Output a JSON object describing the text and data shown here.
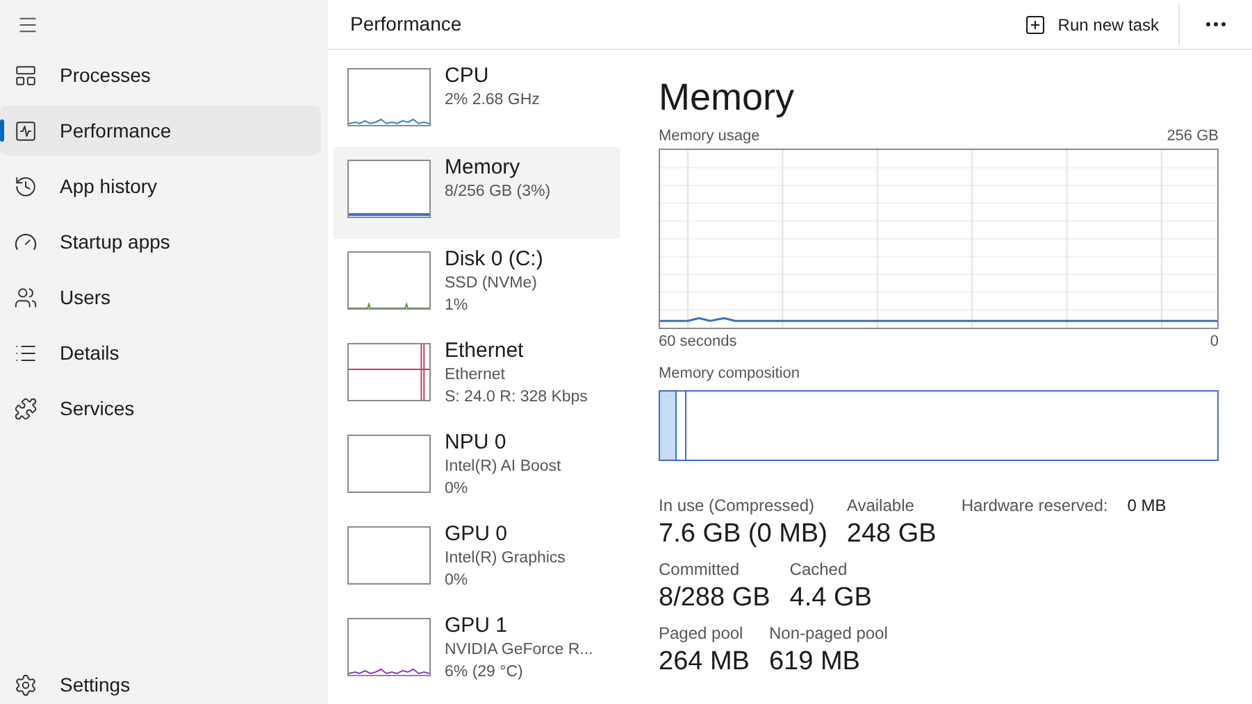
{
  "sidebar": {
    "items": [
      {
        "label": "Processes",
        "kind": "processes",
        "selected": false
      },
      {
        "label": "Performance",
        "kind": "performance",
        "selected": true
      },
      {
        "label": "App history",
        "kind": "history",
        "selected": false
      },
      {
        "label": "Startup apps",
        "kind": "startup",
        "selected": false
      },
      {
        "label": "Users",
        "kind": "users",
        "selected": false
      },
      {
        "label": "Details",
        "kind": "details",
        "selected": false
      },
      {
        "label": "Services",
        "kind": "services",
        "selected": false
      }
    ],
    "settings": "Settings"
  },
  "header": {
    "title": "Performance",
    "run_new_task": "Run new task"
  },
  "devices": [
    {
      "name": "CPU",
      "lines": [
        "2% 2.68 GHz"
      ],
      "kind": "cpu",
      "selected": false
    },
    {
      "name": "Memory",
      "lines": [
        "8/256 GB (3%)"
      ],
      "kind": "memory",
      "selected": true
    },
    {
      "name": "Disk 0 (C:)",
      "lines": [
        "SSD (NVMe)",
        "1%"
      ],
      "kind": "disk",
      "selected": false
    },
    {
      "name": "Ethernet",
      "lines": [
        "Ethernet",
        "S: 24.0 R: 328 Kbps"
      ],
      "kind": "network",
      "selected": false
    },
    {
      "name": "NPU 0",
      "lines": [
        "Intel(R) AI Boost",
        "0%"
      ],
      "kind": "idle",
      "selected": false
    },
    {
      "name": "GPU 0",
      "lines": [
        "Intel(R) Graphics",
        "0%"
      ],
      "kind": "idle",
      "selected": false
    },
    {
      "name": "GPU 1",
      "lines": [
        "NVIDIA GeForce R...",
        "6% (29 °C)"
      ],
      "kind": "gpu",
      "selected": false
    }
  ],
  "detail": {
    "title": "Memory",
    "usage_label": "Memory usage",
    "usage_max": "256 GB",
    "time_span": "60 seconds",
    "usage_min": "0",
    "composition_label": "Memory composition",
    "stats": [
      [
        {
          "label": "In use (Compressed)",
          "value": "7.6 GB (0 MB)"
        },
        {
          "label": "Available",
          "value": "248 GB"
        }
      ],
      [
        {
          "label": "Committed",
          "value": "8/288 GB"
        },
        {
          "label": "Cached",
          "value": "4.4 GB"
        }
      ],
      [
        {
          "label": "Paged pool",
          "value": "264 MB"
        },
        {
          "label": "Non-paged pool",
          "value": "619 MB"
        }
      ]
    ],
    "hardware_reserved": {
      "label": "Hardware reserved:",
      "value": "0 MB"
    }
  }
}
